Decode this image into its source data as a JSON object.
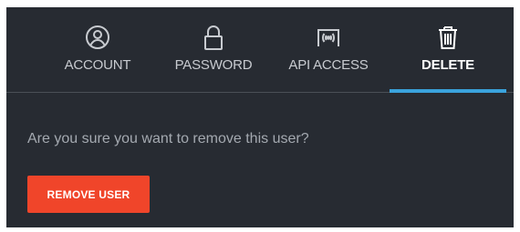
{
  "tabs": [
    {
      "label": "ACCOUNT",
      "icon": "user-circle-icon",
      "active": false
    },
    {
      "label": "PASSWORD",
      "icon": "lock-icon",
      "active": false
    },
    {
      "label": "API ACCESS",
      "icon": "broadcast-icon",
      "active": false
    },
    {
      "label": "DELETE",
      "icon": "trash-icon",
      "active": true
    }
  ],
  "content": {
    "prompt": "Are you sure you want to remove this user?",
    "remove_button_label": "REMOVE USER"
  },
  "colors": {
    "background": "#272b32",
    "active_underline": "#3aa3dc",
    "danger_button": "#f0452a",
    "tab_text": "#c8cbd0",
    "prompt_text": "#a4a9b0"
  }
}
